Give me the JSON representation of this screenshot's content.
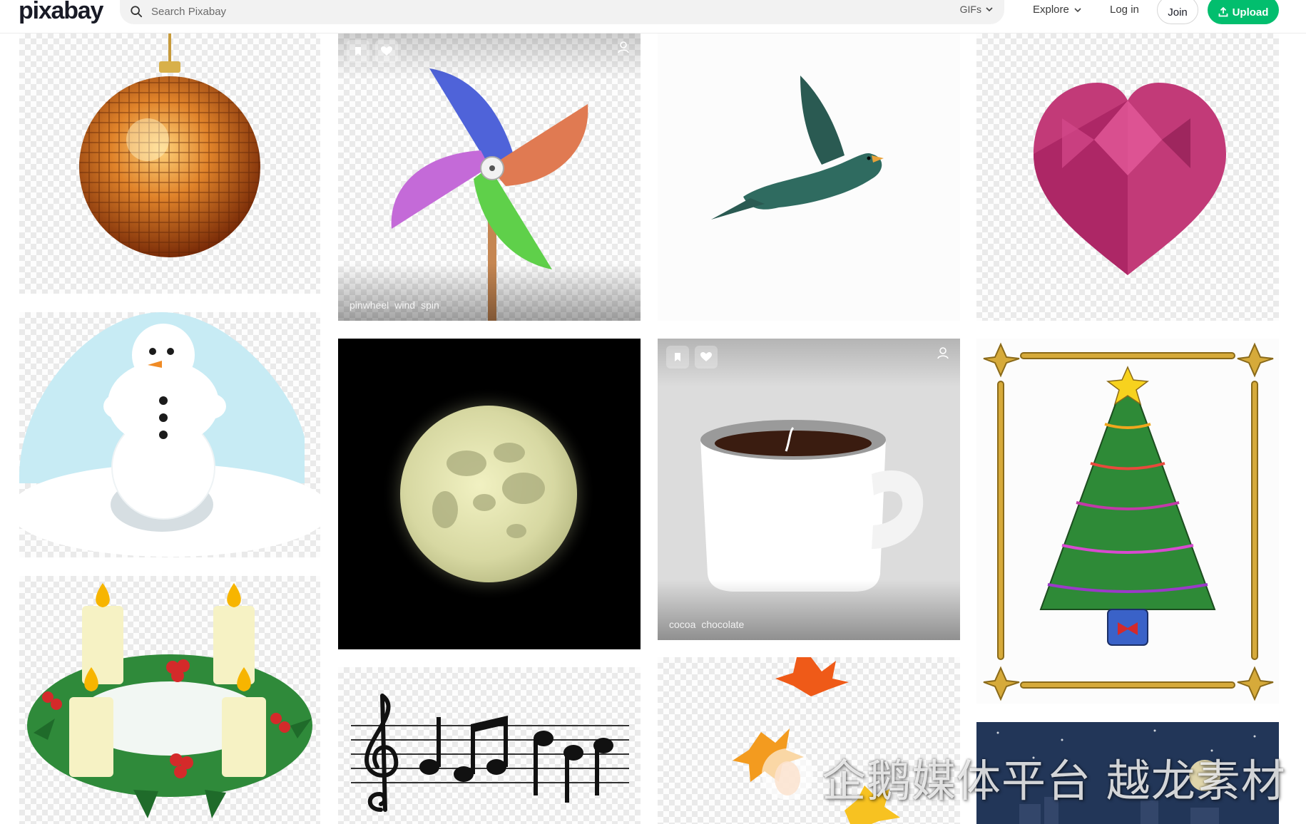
{
  "header": {
    "logo": "pixabay",
    "search_placeholder": "Search Pixabay",
    "media_filter": "GIFs",
    "explore": "Explore",
    "login": "Log in",
    "join": "Join",
    "upload": "Upload"
  },
  "cards": {
    "pinwheel_tags": [
      "pinwheel",
      "wind",
      "spin"
    ],
    "cup_tags": [
      "cocoa",
      "chocolate"
    ]
  },
  "watermark": "企鹅媒体平台 越龙素材",
  "colors": {
    "brand": "#02be6e",
    "text": "#191b26"
  }
}
